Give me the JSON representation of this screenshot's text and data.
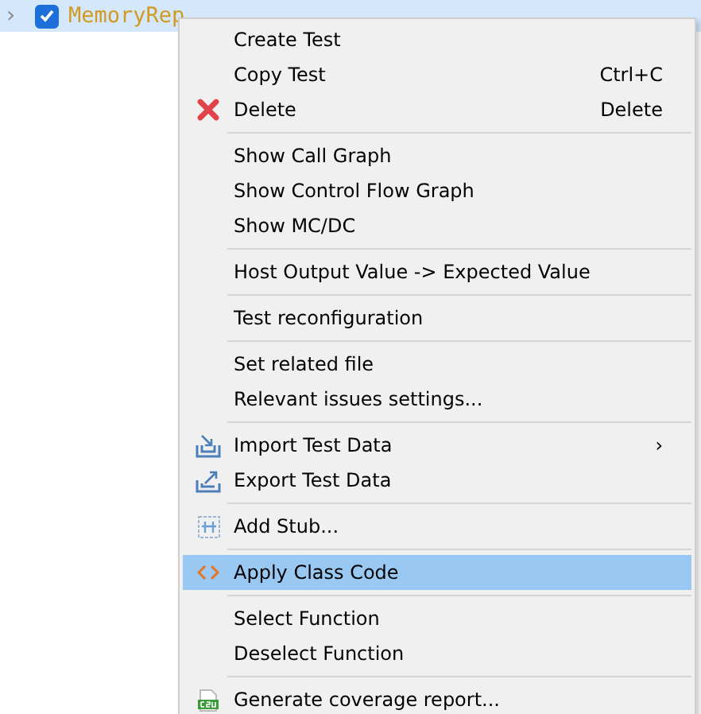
{
  "tree_row": {
    "expander": "›",
    "checked": true,
    "function_name": "MemoryRep"
  },
  "context_menu": [
    {
      "kind": "plain",
      "label": "Create Test",
      "selected": false
    },
    {
      "kind": "plain",
      "label": "Copy Test",
      "shortcut": "Ctrl+C",
      "selected": false
    },
    {
      "kind": "delete",
      "label": "Delete",
      "shortcut": "Delete",
      "selected": false
    },
    {
      "kind": "separator"
    },
    {
      "kind": "plain",
      "label": "Show Call Graph",
      "selected": false
    },
    {
      "kind": "plain",
      "label": "Show Control Flow Graph",
      "selected": false
    },
    {
      "kind": "plain",
      "label": "Show MC/DC",
      "selected": false
    },
    {
      "kind": "separator"
    },
    {
      "kind": "plain",
      "label": "Host Output Value -> Expected Value",
      "selected": false
    },
    {
      "kind": "separator"
    },
    {
      "kind": "plain",
      "label": "Test reconfiguration",
      "selected": false
    },
    {
      "kind": "separator"
    },
    {
      "kind": "plain",
      "label": "Set related file",
      "selected": false
    },
    {
      "kind": "plain",
      "label": "Relevant issues settings...",
      "selected": false
    },
    {
      "kind": "separator"
    },
    {
      "kind": "import",
      "label": "Import Test Data",
      "submenu": "›",
      "selected": false
    },
    {
      "kind": "export",
      "label": "Export Test Data",
      "selected": false
    },
    {
      "kind": "separator"
    },
    {
      "kind": "stub",
      "label": "Add Stub...",
      "selected": false
    },
    {
      "kind": "separator"
    },
    {
      "kind": "code",
      "label": "Apply Class Code",
      "selected": true
    },
    {
      "kind": "separator"
    },
    {
      "kind": "plain",
      "label": "Select Function",
      "selected": false
    },
    {
      "kind": "plain",
      "label": "Deselect Function",
      "selected": false
    },
    {
      "kind": "separator"
    },
    {
      "kind": "csv",
      "label": "Generate coverage report...",
      "selected": false
    }
  ]
}
